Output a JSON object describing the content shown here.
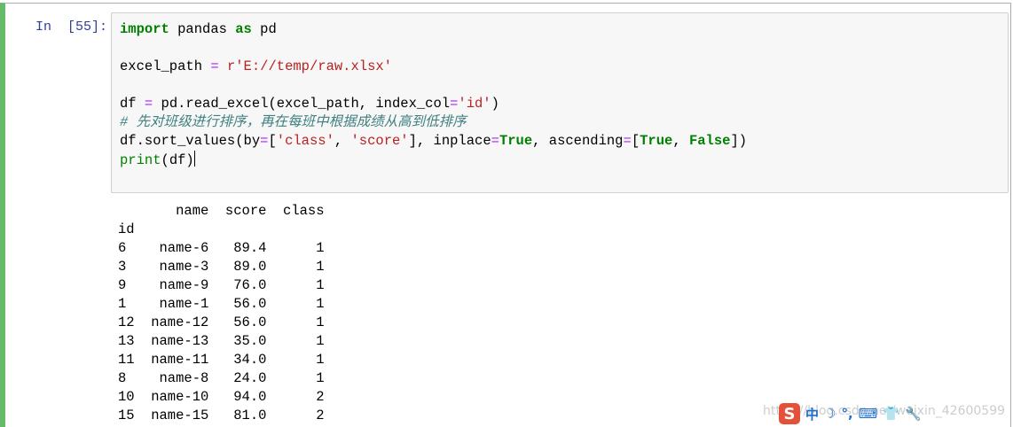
{
  "prompt": "In  [55]:",
  "code": {
    "line1": {
      "kw1": "import",
      "mid": " pandas ",
      "kw2": "as",
      "end": " pd"
    },
    "line2": {
      "a": "excel_path ",
      "op": "=",
      "b": " ",
      "str": "r'E://temp/raw.xlsx'"
    },
    "line3": {
      "a": "df ",
      "op": "=",
      "b": " pd.read_excel(excel_path, index_col",
      "op2": "=",
      "str": "'id'",
      "c": ")"
    },
    "line4": "# 先对班级进行排序，再在每班中根据成绩从高到低排序",
    "line5": {
      "a": "df.sort_values(by",
      "op": "=",
      "b": "[",
      "s1": "'class'",
      "c": ", ",
      "s2": "'score'",
      "d": "], inplace",
      "op2": "=",
      "kw1": "True",
      "e": ", ascending",
      "op3": "=",
      "f": "[",
      "kw2": "True",
      "g": ", ",
      "kw3": "False",
      "h": "])"
    },
    "line6": {
      "a": "print",
      "b": "(df)"
    }
  },
  "output": {
    "header": "       name  score  class",
    "index_label": "id",
    "rows": [
      "6    name-6   89.4      1",
      "3    name-3   89.0      1",
      "9    name-9   76.0      1",
      "1    name-1   56.0      1",
      "12  name-12   56.0      1",
      "13  name-13   35.0      1",
      "11  name-11   34.0      1",
      "8    name-8   24.0      1",
      "10  name-10   94.0      2",
      "15  name-15   81.0      2"
    ]
  },
  "ime": {
    "logo": "S",
    "lang": "中",
    "moon": "☽",
    "punct": "°,",
    "keyboard": "⌨",
    "shirt": "👕",
    "wrench": "🔧"
  },
  "watermark": "https://blog.csdn.net/weixin_42600599"
}
